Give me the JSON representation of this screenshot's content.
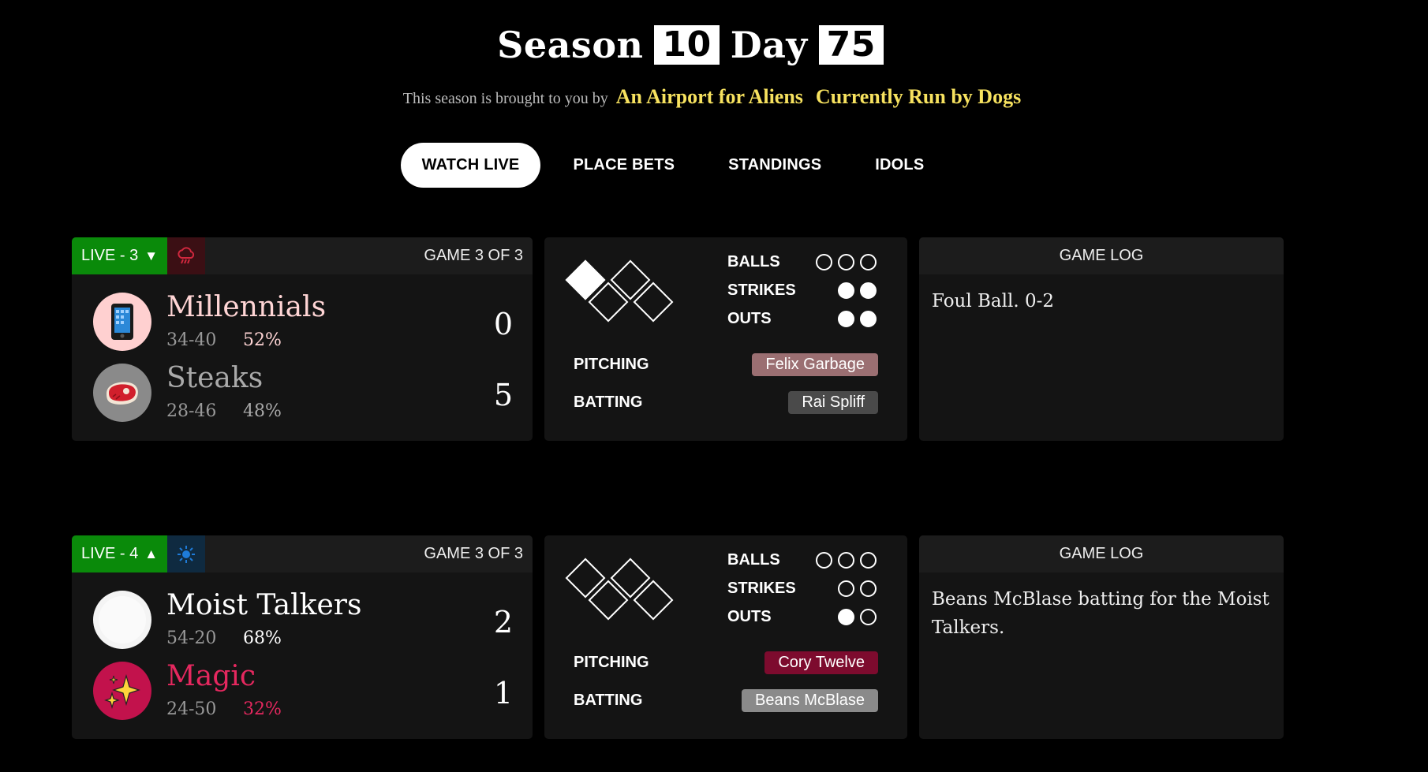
{
  "header": {
    "season_label": "Season",
    "season_number": "10",
    "day_label": "Day",
    "day_number": "75",
    "sponsor_prefix": "This season is brought to you by",
    "sponsors": [
      "An Airport for Aliens",
      "Currently Run by Dogs"
    ]
  },
  "nav": {
    "items": [
      "WATCH LIVE",
      "PLACE BETS",
      "STANDINGS",
      "IDOLS"
    ],
    "active": "WATCH LIVE"
  },
  "games": [
    {
      "live_label": "LIVE - 3",
      "inning_arrow": "▼",
      "weather_icon": "rain-cloud-icon",
      "game_of": "GAME 3 OF 3",
      "away": {
        "name": "Millennials",
        "record": "34-40",
        "pct": "52%",
        "score": "0",
        "logo": "mobile-phone-icon",
        "name_color": "#ffd5d5",
        "pct_color": "#ffd5d5",
        "logo_bg": "#ffd0d0"
      },
      "home": {
        "name": "Steaks",
        "record": "28-46",
        "pct": "48%",
        "score": "5",
        "logo": "steak-icon",
        "name_color": "#aaaaaa",
        "pct_color": "#aaaaaa",
        "logo_bg": "#8a8a8a"
      },
      "bases": {
        "first": false,
        "second": false,
        "third": true
      },
      "count": {
        "balls_label": "BALLS",
        "strikes_label": "STRIKES",
        "outs_label": "OUTS",
        "balls": 0,
        "balls_max": 3,
        "strikes": 2,
        "strikes_max": 2,
        "outs": 2,
        "outs_max": 2
      },
      "pitching_label": "PITCHING",
      "batting_label": "BATTING",
      "pitcher": {
        "name": "Felix Garbage",
        "color": "#9b6f72"
      },
      "batter": {
        "name": "Rai Spliff",
        "color": "#4a4a4a"
      },
      "log_title": "GAME LOG",
      "log_text": "Foul Ball. 0-2"
    },
    {
      "live_label": "LIVE - 4",
      "inning_arrow": "▲",
      "weather_icon": "sun-icon",
      "game_of": "GAME 3 OF 3",
      "away": {
        "name": "Moist Talkers",
        "record": "54-20",
        "pct": "68%",
        "score": "2",
        "logo": "white-circle-icon",
        "name_color": "#ffffff",
        "pct_color": "#ffffff",
        "logo_bg": "#f4f4f4"
      },
      "home": {
        "name": "Magic",
        "record": "24-50",
        "pct": "32%",
        "score": "1",
        "logo": "sparkles-icon",
        "name_color": "#e5285f",
        "pct_color": "#e5285f",
        "logo_bg": "#c2124c"
      },
      "bases": {
        "first": false,
        "second": false,
        "third": false
      },
      "count": {
        "balls_label": "BALLS",
        "strikes_label": "STRIKES",
        "outs_label": "OUTS",
        "balls": 0,
        "balls_max": 3,
        "strikes": 0,
        "strikes_max": 2,
        "outs": 1,
        "outs_max": 2
      },
      "pitching_label": "PITCHING",
      "batting_label": "BATTING",
      "pitcher": {
        "name": "Cory Twelve",
        "color": "#7d0b2e"
      },
      "batter": {
        "name": "Beans McBlase",
        "color": "#8a8a8a"
      },
      "log_title": "GAME LOG",
      "log_text": "Beans McBlase batting for the Moist Talkers."
    }
  ]
}
